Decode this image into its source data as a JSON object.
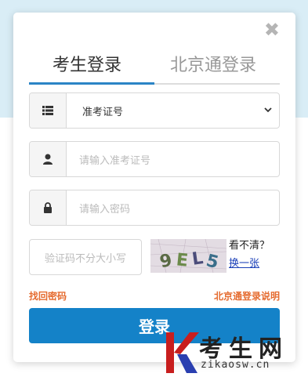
{
  "dialog": {
    "close_icon": "close-icon"
  },
  "tabs": [
    {
      "label": "考生登录",
      "active": true
    },
    {
      "label": "北京通登录",
      "active": false
    }
  ],
  "form": {
    "id_type": {
      "selected": "准考证号",
      "icon": "list-icon"
    },
    "exam_id": {
      "placeholder": "请输入准考证号",
      "icon": "user-icon"
    },
    "password": {
      "placeholder": "请输入密码",
      "icon": "lock-icon"
    },
    "captcha": {
      "placeholder": "验证码不分大小写",
      "image_text": "9EL5",
      "unclear_label": "看不清？",
      "refresh_label": "换一张"
    }
  },
  "links": {
    "forgot_password": "找回密码",
    "bjt_help": "北京通登录说明"
  },
  "login_button": "登录",
  "watermark": {
    "brand": "考生网",
    "domain": "zikaosw.cn"
  },
  "colors": {
    "accent": "#1482c8",
    "tab_underline": "#2b84c6",
    "link": "#e56b2f",
    "top_background": "#d9edf6"
  }
}
